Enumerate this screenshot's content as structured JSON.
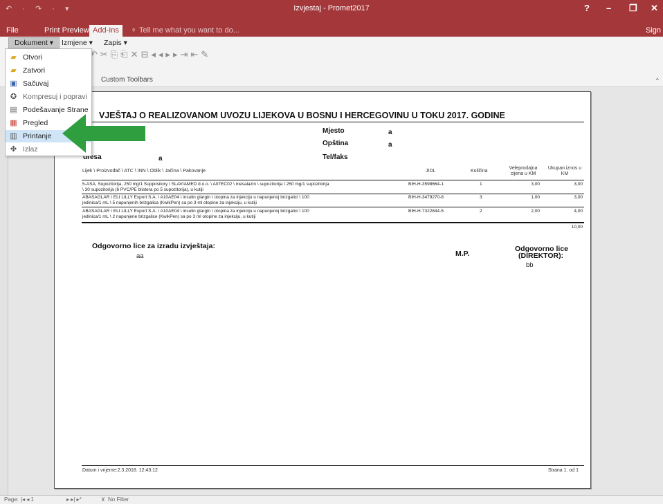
{
  "window": {
    "title": "Izvjestaj - Promet2017",
    "qat": "↶ · ↷ · ▾",
    "help": "?",
    "minimize": "–",
    "restore": "❐",
    "close": "✕"
  },
  "menu": {
    "file": "File",
    "print_preview": "Print Preview",
    "addins": "Add-Ins",
    "tell_me": "Tell me what you want to do...",
    "sign_in": "Sign"
  },
  "ribbon": {
    "dokument": "Dokument ▾",
    "izmjene": "Izmjene ▾",
    "zapis": "Zapis ▾",
    "group_label": "Custom Toolbars",
    "collapse": "^",
    "toolbar_glyphs": "↶✂⎘⎗✕⊟◂◂▸▸⇥⇤✎"
  },
  "dropdown": {
    "items": [
      {
        "label": "Otvori",
        "icon": "folder-open-icon",
        "glyph": "▰"
      },
      {
        "label": "Zatvori",
        "icon": "folder-icon",
        "glyph": "▰"
      },
      {
        "label": "Sačuvaj",
        "icon": "save-icon",
        "glyph": "▣"
      },
      {
        "label": "Kompresuj i popravi",
        "icon": "repair-icon",
        "glyph": "✪"
      },
      {
        "label": "Podešavanje Strane",
        "icon": "page-setup-icon",
        "glyph": "▤"
      },
      {
        "label": "Pregled",
        "icon": "preview-icon",
        "glyph": "▦"
      },
      {
        "label": "Printanje",
        "icon": "printer-icon",
        "glyph": "▥"
      },
      {
        "label": "Izlaz",
        "icon": "exit-icon",
        "glyph": "✤"
      }
    ]
  },
  "report": {
    "title": "VJEŠTAJ O REALIZOVANOM UVOZU LIJEKOVA U BOSNU I HERCEGOVINU U TOKU 2017. GODINE",
    "adresa_label": "dresa",
    "adresa_value": "a",
    "mjesto_label": "Mjesto",
    "mjesto_value": "a",
    "opstina_label": "Opština",
    "opstina_value": "a",
    "telfaks_label": "Tel/faks",
    "columns": {
      "lijek": "Lijek \\ Proizvođač \\ ATC \\ INN \\ Oblik \\ Jačina \\ Pakovanje",
      "jidl": "JIDL",
      "kolicina": "Količina",
      "cijena": "Veleprodajna cijena u KM",
      "ukupno": "Ukupan iznos u KM"
    },
    "rows": [
      {
        "line1": "5-ASA, Supozitorija, 250 mg/1 Suppository \\ SLAVIAMED d.o.o. \\ A07EC02 \\ mesalazin \\ supozitorija \\ 250 mg/1 supozitorija",
        "line2": "\\ 30 supozitorija (6 PVC/PE blistera po 5 supozitorija), u kutiji",
        "jidl": "BIH-H-3598664-1",
        "kolicina": "1",
        "cijena": "3,00",
        "ukupno": "3,00"
      },
      {
        "line1": "ABASAGLAR \\ ELI LILLY Export S.A. \\ A10AE04 \\ insulin glargin \\ otopina za injekciju u napunjenoj brizgalici \\ 100",
        "line2": "jedinica/1 mL \\ 5 napunjenih brizgalica (KwikPen) sa po 3 ml otopine za injekciju, u kutiji",
        "jidl": "BIH-H-3479270-8",
        "kolicina": "3",
        "cijena": "1,00",
        "ukupno": "3,00"
      },
      {
        "line1": "ABASAGLAR \\ ELI LILLY Export S.A. \\ A10AE04 \\ insulin glargin \\ otopina za injekciju u napunjenoj brizgalici \\ 100",
        "line2": "jedinica/1 mL \\ 2 napunjene brizgalice (KwikPen) sa po 3 ml otopine za injekciju, u kutiji",
        "jidl": "BIH-H-7322844-5",
        "kolicina": "2",
        "cijena": "2,00",
        "ukupno": "4,00"
      }
    ],
    "total": "10,00",
    "odgovorno_lice_izrada": "Odgovorno lice za izradu izvještaja:",
    "odgovorno_lice_izrada_value": "aa",
    "mp": "M.P.",
    "odgovorno_lice": "Odgovorno lice",
    "direktor": "(DIREKTOR):",
    "direktor_value": "bb",
    "datum": "Datum i vrijeme:2.3.2018. 12:43:12",
    "strana": "Strana 1. od 1"
  },
  "status": {
    "page_label": "Page:",
    "nav": "|◂  ◂  1",
    "nav2": "▸  ▸|  ▸*",
    "filter": "No Filter"
  },
  "colors": {
    "accent": "#a4373a",
    "arrow": "#2e9e3f"
  }
}
